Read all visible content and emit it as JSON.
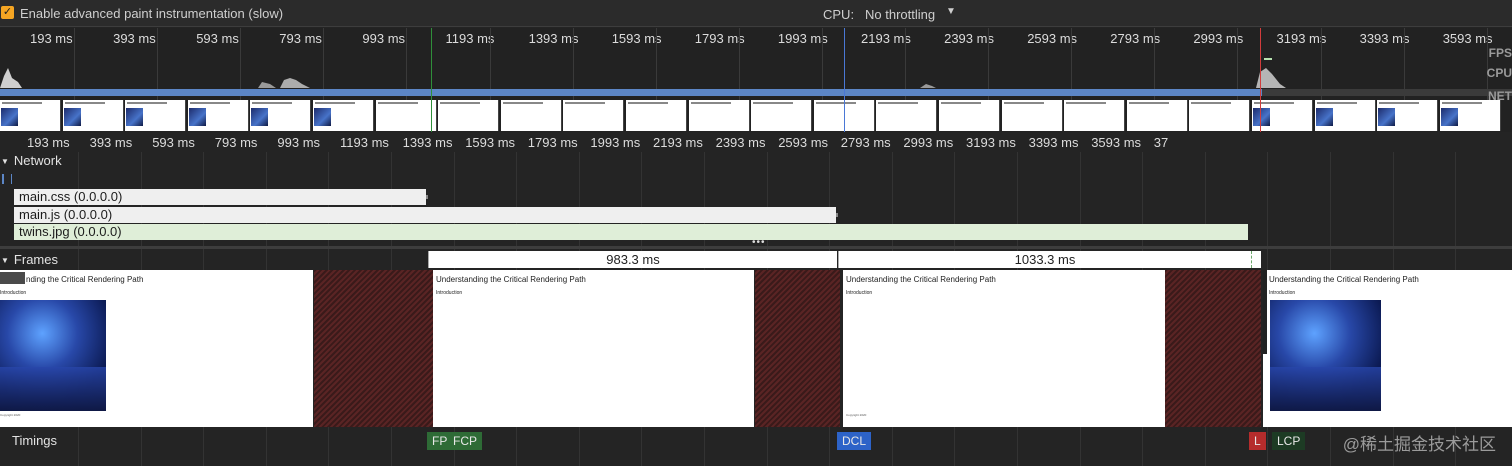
{
  "toolbar": {
    "checkbox_checked": "✓",
    "advanced_paint_label": "Enable advanced paint instrumentation (slow)",
    "cpu_label": "CPU:",
    "cpu_value": "No throttling",
    "cpu_caret": "▼"
  },
  "ruler_ticks": [
    "193 ms",
    "393 ms",
    "593 ms",
    "793 ms",
    "993 ms",
    "1193 ms",
    "1393 ms",
    "1593 ms",
    "1793 ms",
    "1993 ms",
    "2193 ms",
    "2393 ms",
    "2593 ms",
    "2793 ms",
    "2993 ms",
    "3193 ms",
    "3393 ms",
    "3593 ms"
  ],
  "ruler_ticks_bottom": [
    "193 ms",
    "393 ms",
    "593 ms",
    "793 ms",
    "993 ms",
    "1193 ms",
    "1393 ms",
    "1593 ms",
    "1793 ms",
    "1993 ms",
    "2193 ms",
    "2393 ms",
    "2593 ms",
    "2793 ms",
    "2993 ms",
    "3193 ms",
    "3393 ms",
    "3593 ms",
    "37"
  ],
  "overview_tracks": [
    "FPS",
    "CPU",
    "NET"
  ],
  "network": {
    "header": "Network",
    "requests": [
      {
        "name": "main.css (0.0.0.0)"
      },
      {
        "name": "main.js (0.0.0.0)"
      },
      {
        "name": "twins.jpg (0.0.0.0)"
      }
    ]
  },
  "frames": {
    "header": "Frames",
    "durations": [
      "983.3 ms",
      "1033.3 ms"
    ],
    "screenshot_title": "Understanding the Critical Rendering Path",
    "screenshot_intro": "Introduction",
    "screenshot_copyright": "Copyright 2020",
    "first_title_partial": "nding the Critical Rendering Path"
  },
  "timings": {
    "header": "Timings",
    "markers": [
      "FP",
      "FCP",
      "DCL",
      "L",
      "LCP"
    ]
  },
  "watermark": "@稀土掘金技术社区",
  "colors": {
    "fp_green": "#2e6b36",
    "dcl_blue": "#2d63c8",
    "load_red": "#b52c2c",
    "checkbox": "#f6a623"
  }
}
